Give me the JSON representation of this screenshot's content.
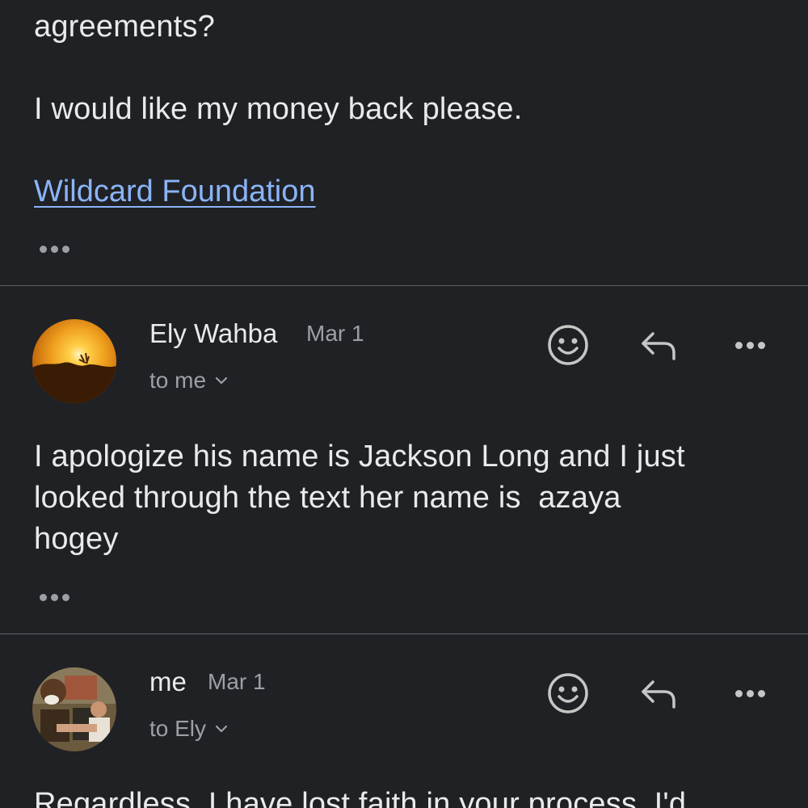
{
  "message1": {
    "partial_line": "agreements?",
    "paragraph": "I would like my money back please.",
    "signature_link": "Wildcard Foundation"
  },
  "message2": {
    "sender": "Ely Wahba",
    "date": "Mar 1",
    "to": "to me",
    "body_lines": [
      "I apologize his name is Jackson Long and I just",
      "looked through the text her name is  azaya",
      "hogey"
    ],
    "avatar": "sunset-photo"
  },
  "message3": {
    "sender": "me",
    "date": "Mar 1",
    "to": "to Ely",
    "body_partial": "Regardless, I have lost faith in your process. I'd",
    "avatar": "person-photo"
  },
  "icons": {
    "react": "emoji-smile-icon",
    "reply": "reply-arrow-icon",
    "more": "more-horizontal-icon",
    "expand": "chevron-down-icon",
    "trimmed": "ellipsis-icon"
  },
  "colors": {
    "background": "#202124",
    "text": "#e8eaed",
    "secondary_text": "#9aa0a6",
    "link": "#8ab4f8",
    "divider": "#5f6368"
  }
}
